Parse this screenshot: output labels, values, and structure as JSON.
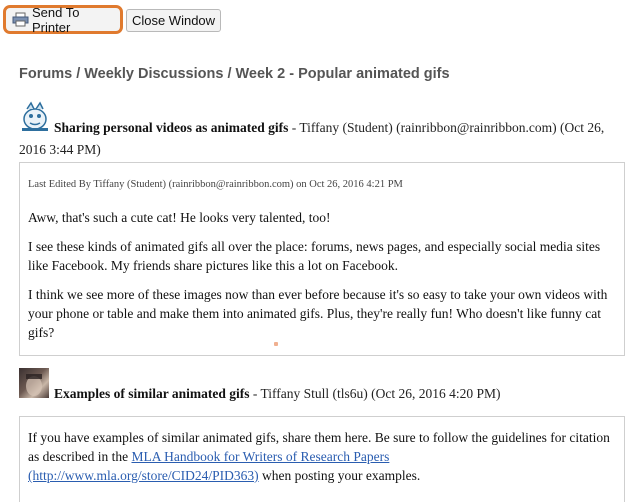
{
  "toolbar": {
    "send_to_printer": "Send To Printer",
    "close_window": "Close Window"
  },
  "breadcrumb": "Forums / Weekly Discussions / Week 2 - Popular animated gifs",
  "post1": {
    "title": "Sharing personal videos as animated gifs",
    "meta_line1": " - Tiffany (Student) (rainribbon@rainribbon.com) (Oct 26,",
    "meta_line2": "2016 3:44 PM)",
    "edited": "Last Edited By Tiffany (Student) (rainribbon@rainribbon.com) on Oct 26, 2016 4:21 PM",
    "p1": "Aww, that's such a cute cat!  He looks very talented, too!",
    "p2": "I see these kinds of animated gifs all over the place: forums, news pages, and especially social media sites like Facebook.  My friends share pictures like this a lot on Facebook.",
    "p3": "I think we see more of these images now than ever before because it's so easy to take your own videos with your phone or table and make them into animated gifs.  Plus, they're really fun!  Who doesn't like funny cat gifs?"
  },
  "post2": {
    "title": "Examples of similar animated gifs",
    "meta": " - Tiffany Stull (tls6u) (Oct 26, 2016 4:20 PM)",
    "body_start": "If you have examples of similar animated gifs, share them here.  Be sure to follow the guidelines for citation as described in the ",
    "link_text": "MLA Handbook for Writers of Research Papers (http://www.mla.org/store/CID24/PID363)",
    "body_end": " when posting your examples."
  },
  "icons": {
    "printer": "printer-icon",
    "avatar1": "cartoon-avatar",
    "avatar2": "photo-avatar"
  }
}
